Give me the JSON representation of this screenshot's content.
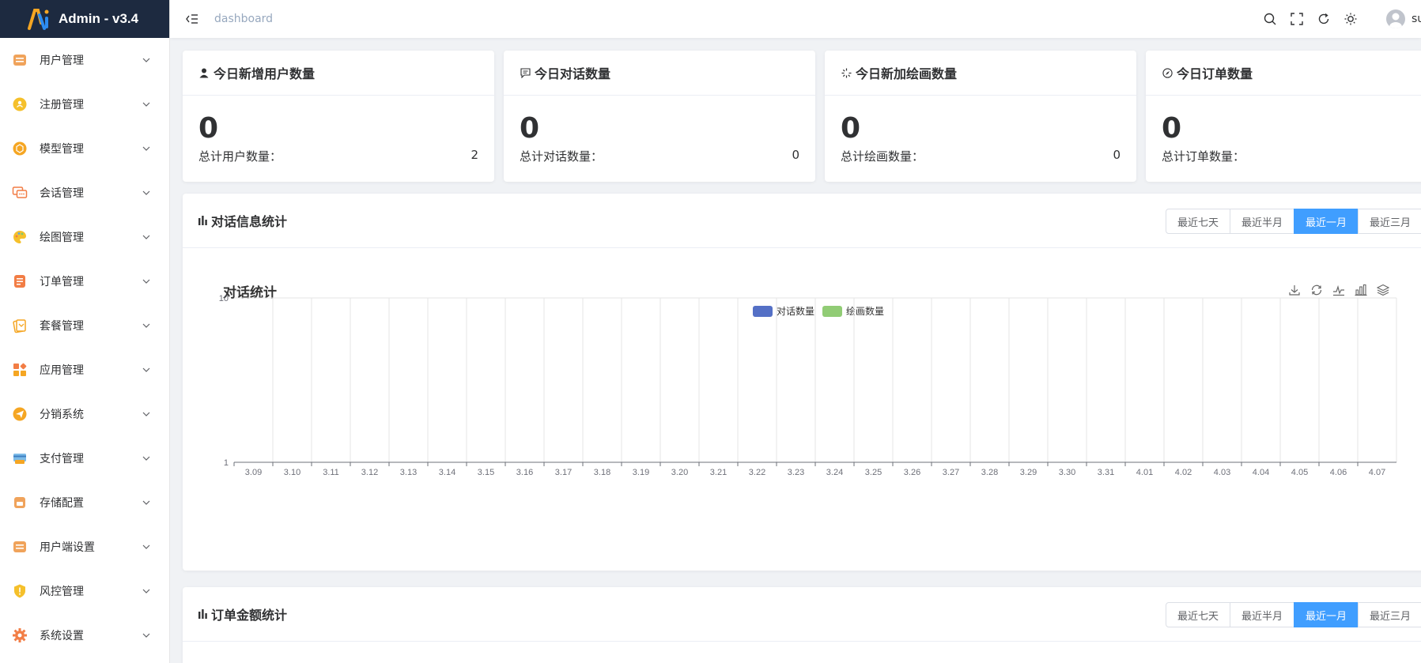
{
  "app": {
    "title": "Admin - v3.4"
  },
  "sidebar": {
    "items": [
      {
        "label": "用户管理",
        "icon": "user-management-icon",
        "color": "#f0a35b"
      },
      {
        "label": "注册管理",
        "icon": "register-icon",
        "color": "#f5c02b"
      },
      {
        "label": "模型管理",
        "icon": "model-icon",
        "color": "#f5a623"
      },
      {
        "label": "会话管理",
        "icon": "chat-icon",
        "color": "#f27d45"
      },
      {
        "label": "绘图管理",
        "icon": "palette-icon",
        "color": "#f5c02b"
      },
      {
        "label": "订单管理",
        "icon": "order-icon",
        "color": "#f27d45"
      },
      {
        "label": "套餐管理",
        "icon": "package-icon",
        "color": "#f5a623"
      },
      {
        "label": "应用管理",
        "icon": "apps-icon",
        "color": "#f27d45"
      },
      {
        "label": "分销系统",
        "icon": "send-icon",
        "color": "#f5a623"
      },
      {
        "label": "支付管理",
        "icon": "payment-icon",
        "color": "#f5a623"
      },
      {
        "label": "存储配置",
        "icon": "storage-icon",
        "color": "#f0a35b"
      },
      {
        "label": "用户端设置",
        "icon": "client-settings-icon",
        "color": "#f0a35b"
      },
      {
        "label": "风控管理",
        "icon": "shield-icon",
        "color": "#f5c02b"
      },
      {
        "label": "系统设置",
        "icon": "gear-icon",
        "color": "#f27d45"
      }
    ]
  },
  "header": {
    "breadcrumb": "dashboard",
    "username": "su"
  },
  "cards": [
    {
      "title": "今日新增用户数量",
      "icon": "user-icon",
      "value": "0",
      "total_label": "总计用户数量：",
      "total_value": "2"
    },
    {
      "title": "今日对话数量",
      "icon": "message-icon",
      "value": "0",
      "total_label": "总计对话数量：",
      "total_value": "0"
    },
    {
      "title": "今日新加绘画数量",
      "icon": "sparkle-icon",
      "value": "0",
      "total_label": "总计绘画数量：",
      "total_value": "0"
    },
    {
      "title": "今日订单数量",
      "icon": "compass-icon",
      "value": "0",
      "total_label": "总计订单数量：",
      "total_value": ""
    }
  ],
  "chat_panel": {
    "title": "对话信息统计",
    "ranges": [
      "最近七天",
      "最近半月",
      "最近一月",
      "最近三月"
    ],
    "active_range": "最近一月"
  },
  "order_panel": {
    "title": "订单金额统计",
    "ranges": [
      "最近七天",
      "最近半月",
      "最近一月",
      "最近三月"
    ],
    "active_range": "最近一月"
  },
  "toolbox": [
    "download-icon",
    "refresh-icon",
    "line-chart-icon",
    "bar-chart-icon",
    "stack-icon"
  ],
  "chart_data": {
    "type": "bar",
    "title": "对话统计",
    "categories": [
      "3.09",
      "3.10",
      "3.11",
      "3.12",
      "3.13",
      "3.14",
      "3.15",
      "3.16",
      "3.17",
      "3.18",
      "3.19",
      "3.20",
      "3.21",
      "3.22",
      "3.23",
      "3.24",
      "3.25",
      "3.26",
      "3.27",
      "3.28",
      "3.29",
      "3.30",
      "3.31",
      "4.01",
      "4.02",
      "4.03",
      "4.04",
      "4.05",
      "4.06",
      "4.07"
    ],
    "series": [
      {
        "name": "对话数量",
        "color": "#5470c6",
        "values": [
          0,
          0,
          0,
          0,
          0,
          0,
          0,
          0,
          0,
          0,
          0,
          0,
          0,
          0,
          0,
          0,
          0,
          0,
          0,
          0,
          0,
          0,
          0,
          0,
          0,
          0,
          0,
          0,
          0,
          0
        ]
      },
      {
        "name": "绘画数量",
        "color": "#91cc75",
        "values": [
          0,
          0,
          0,
          0,
          0,
          0,
          0,
          0,
          0,
          0,
          0,
          0,
          0,
          0,
          0,
          0,
          0,
          0,
          0,
          0,
          0,
          0,
          0,
          0,
          0,
          0,
          0,
          0,
          0,
          0
        ]
      }
    ],
    "y_axis": {
      "scale": "log",
      "ticks": [
        "1",
        "10"
      ],
      "ylim": [
        1,
        10
      ]
    },
    "xlabel": "",
    "ylabel": "",
    "grid": true,
    "legend_position": "top-center"
  },
  "colors": {
    "accent": "#409eff",
    "sidebar_logo_bg": "#1d2a40"
  }
}
